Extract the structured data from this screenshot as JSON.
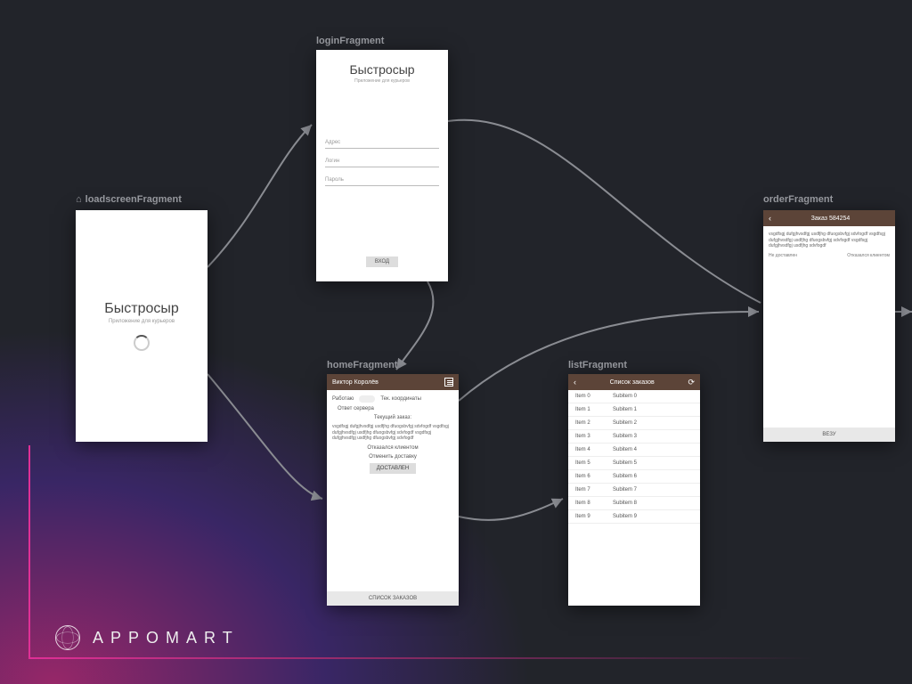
{
  "brand": "APPOMART",
  "fragments": {
    "loadscreen": {
      "label": "loadscreenFragment",
      "title": "Быстросыр",
      "subtitle": "Приложение для курьеров"
    },
    "login": {
      "label": "loginFragment",
      "title": "Быстросыр",
      "subtitle": "Приложение для курьеров",
      "fields": {
        "address": "Адрес",
        "login": "Логин",
        "password": "Пароль"
      },
      "button": "ВХОД"
    },
    "home": {
      "label": "homeFragment",
      "user": "Виктор Королёв",
      "row_work": "Работаю",
      "row_coords": "Тек. координаты",
      "row_server": "Ответ сервера",
      "current_order": "Текущий заказ:",
      "lorem": "vsgdfsgj dufgjhvsdfgj usdfjhg dfuogsbvfgj sdvfogdf vsgdfsgj dufgjhvsdfgj usdfjhg dfuogsbvfgj sdvfogdf vsgdfsgj dufgjhvsdfgj usdfjhg dfuogsbvfgj sdvfogdf",
      "cancel_client": "Отказался клиентом",
      "cancel_delivery": "Отменить доставку",
      "delivered": "ДОСТАВЛЕН",
      "footer": "СПИСОК ЗАКАЗОВ"
    },
    "list": {
      "label": "listFragment",
      "title": "Список заказов",
      "items": [
        {
          "a": "Item 0",
          "b": "Subitem 0"
        },
        {
          "a": "Item 1",
          "b": "Subitem 1"
        },
        {
          "a": "Item 2",
          "b": "Subitem 2"
        },
        {
          "a": "Item 3",
          "b": "Subitem 3"
        },
        {
          "a": "Item 4",
          "b": "Subitem 4"
        },
        {
          "a": "Item 5",
          "b": "Subitem 5"
        },
        {
          "a": "Item 6",
          "b": "Subitem 6"
        },
        {
          "a": "Item 7",
          "b": "Subitem 7"
        },
        {
          "a": "Item 8",
          "b": "Subitem 8"
        },
        {
          "a": "Item 9",
          "b": "Subitem 9"
        }
      ]
    },
    "order": {
      "label": "orderFragment",
      "title": "Заказ 584254",
      "lorem": "vsgdfsgj dufgjhvsdfgj usdfjhg dfuogsbvfgj sdvfogdf vsgdfsgj dufgjhvsdfgj usdfjhg dfuogsbvfgj sdvfogdf vsgdfsgj dufgjhvsdfgj usdfjhg sdvfogdf",
      "status_left": "Не доставлен",
      "status_right": "Отказался клиентом",
      "button": "ВЕЗУ"
    }
  }
}
